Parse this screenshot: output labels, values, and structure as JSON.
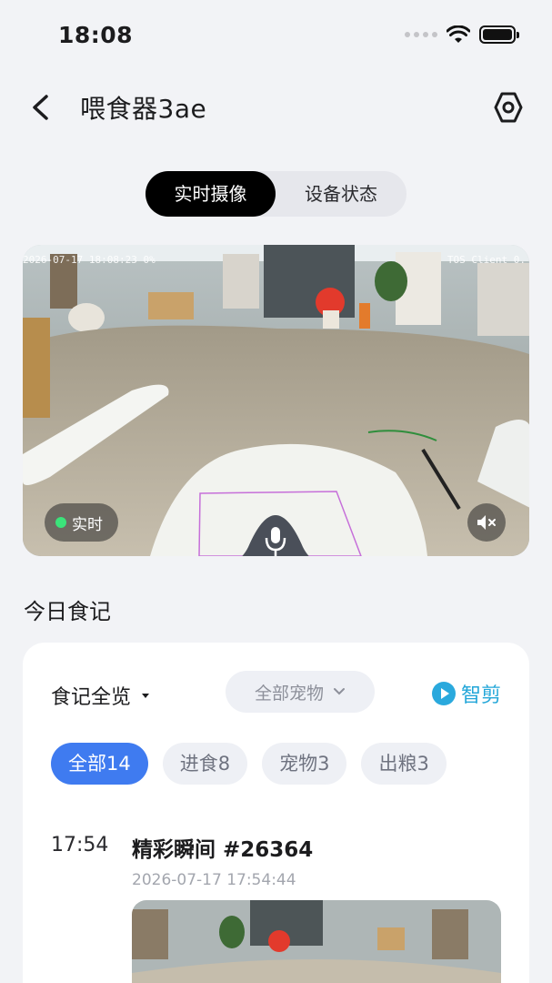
{
  "status_bar": {
    "time": "18:08"
  },
  "nav": {
    "title": "喂食器3ae"
  },
  "tabs": [
    {
      "label": "实时摄像",
      "active": true
    },
    {
      "label": "设备状态",
      "active": false
    }
  ],
  "video": {
    "osd_left": "2026-07-17 18:08:23 0%",
    "osd_right": "TOS Client 0.",
    "live_label": "实时"
  },
  "section": {
    "title": "今日食记"
  },
  "card": {
    "title": "食记全览",
    "pet_filter": "全部宠物",
    "smart_cut": "智剪",
    "chips": [
      {
        "label": "全部14",
        "active": true
      },
      {
        "label": "进食8",
        "active": false
      },
      {
        "label": "宠物3",
        "active": false
      },
      {
        "label": "出粮3",
        "active": false
      }
    ],
    "record": {
      "time": "17:54",
      "title": "精彩瞬间 #26364",
      "date": "2026-07-17 17:54:44"
    }
  },
  "colors": {
    "accent_blue": "#3f7bf0",
    "smart_cut_blue": "#22a6d8",
    "live_green": "#3be37a"
  }
}
